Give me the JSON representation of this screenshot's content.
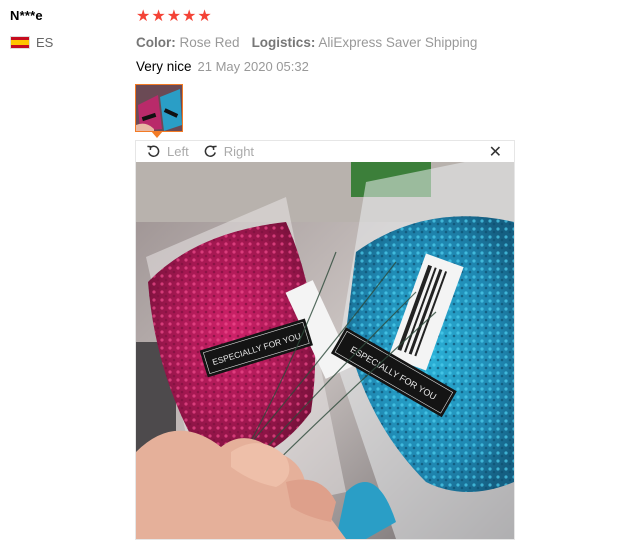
{
  "reviewer": {
    "name": "N***e",
    "country_code": "ES"
  },
  "review": {
    "rating": 5,
    "star_color": "#f44336",
    "color_label": "Color:",
    "color_value": "Rose Red",
    "logistics_label": "Logistics:",
    "logistics_value": "AliExpress Saver Shipping",
    "text": "Very nice",
    "date": "21 May 2020 05:32"
  },
  "viewer": {
    "rotate_left_label": "Left",
    "rotate_right_label": "Right",
    "close_icon": "close-icon",
    "photo_label_left": "ESPECIALLY FOR YOU",
    "photo_label_right": "ESPECIALLY FOR YOU"
  },
  "accent_color": "#f37b25"
}
